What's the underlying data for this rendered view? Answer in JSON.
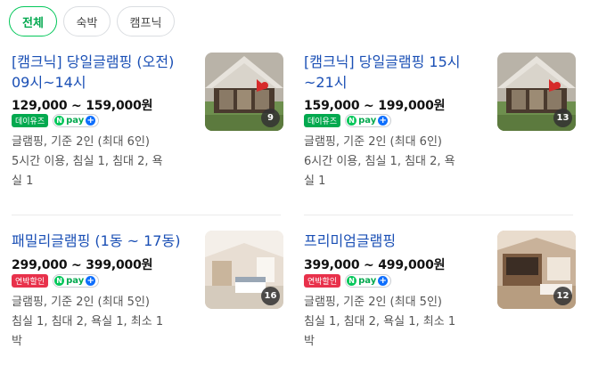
{
  "filters": [
    {
      "label": "전체",
      "active": true
    },
    {
      "label": "숙박",
      "active": false
    },
    {
      "label": "캠프닉",
      "active": false
    }
  ],
  "items": [
    {
      "title_line1": "[캠크닉] 당일글램핑 (오전)",
      "title_line2": "09시~14시",
      "price": "129,000 ~ 159,000원",
      "badge": "데이유즈",
      "badge_color": "#03a94f",
      "npay_text": "pay",
      "desc_line1": "글램핑, 기준 2인 (최대 6인)",
      "desc_line2": "5시간 이용, 침실 1, 침대 2, 욕",
      "desc_line3": "실 1",
      "photo_count": "9"
    },
    {
      "title_line1": "[캠크닉] 당일글램핑 15시",
      "title_line2": "~21시",
      "price": "159,000 ~ 199,000원",
      "badge": "데이유즈",
      "badge_color": "#03a94f",
      "npay_text": "pay",
      "desc_line1": "글램핑, 기준 2인 (최대 6인)",
      "desc_line2": "6시간 이용, 침실 1, 침대 2, 욕",
      "desc_line3": "실 1",
      "photo_count": "13"
    },
    {
      "title_line1": "패밀리글램핑 (1동 ~ 17동)",
      "title_line2": "",
      "price": "299,000 ~ 399,000원",
      "badge": "연박할인",
      "badge_color": "#e8314b",
      "npay_text": "pay",
      "desc_line1": "글램핑, 기준 2인 (최대 5인)",
      "desc_line2": "침실 1, 침대 2, 욕실 1, 최소 1",
      "desc_line3": "박",
      "photo_count": "16"
    },
    {
      "title_line1": "프리미엄글램핑",
      "title_line2": "",
      "price": "399,000 ~ 499,000원",
      "badge": "연박할인",
      "badge_color": "#e8314b",
      "npay_text": "pay",
      "desc_line1": "글램핑, 기준 2인 (최대 5인)",
      "desc_line2": "침실 1, 침대 2, 욕실 1, 최소 1",
      "desc_line3": "박",
      "photo_count": "12"
    }
  ]
}
